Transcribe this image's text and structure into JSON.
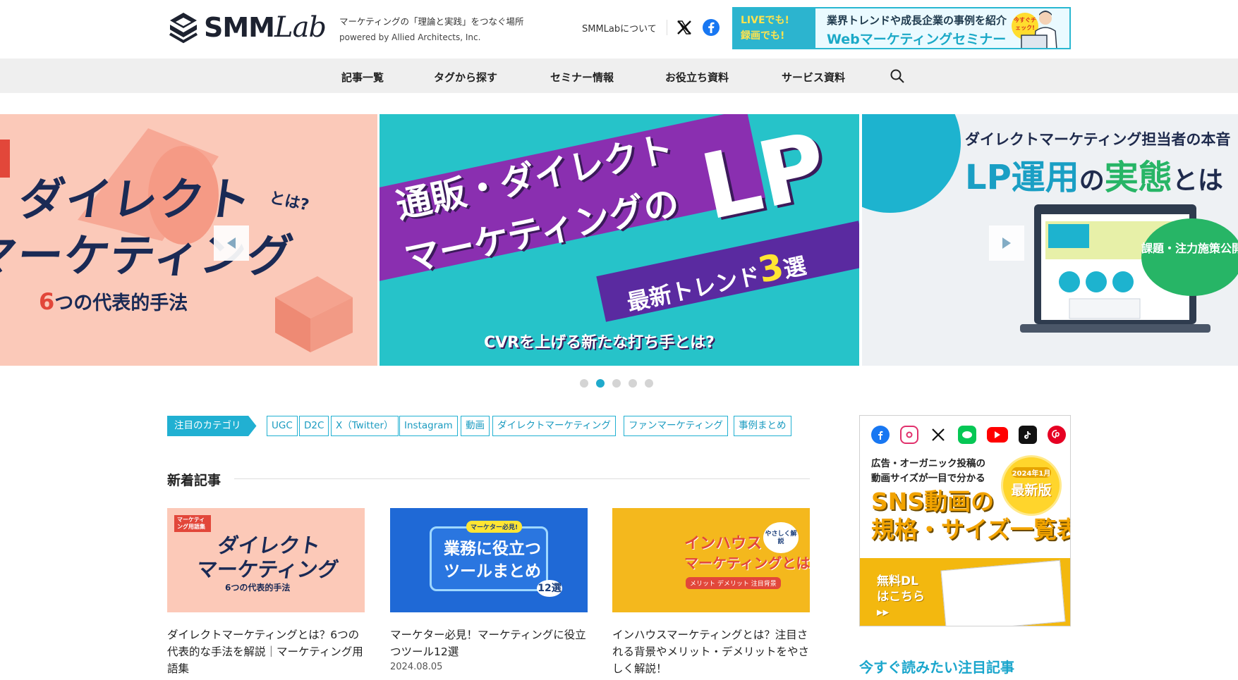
{
  "header": {
    "logo_text": "SMM",
    "logo_text_lab": "Lab",
    "tagline": "マーケティングの「理論と実践」をつなぐ場所",
    "powered_by": "powered by Allied Architects, Inc.",
    "about_link": "SMMLabについて",
    "seminar": {
      "live": "LIVEでも!",
      "recorded": "録画でも!",
      "line1": "業界トレンドや成長企業の事例を紹介",
      "line2": "Webマーケティングセミナー",
      "badge": "今すぐチェック!"
    }
  },
  "nav": {
    "items": [
      "記事一覧",
      "タグから探す",
      "セミナー情報",
      "お役立ち資料",
      "サービス資料"
    ]
  },
  "carousel": {
    "left": {
      "line1": "ダイレクト",
      "line2": "マーケティング",
      "toha": "とは?",
      "sub_num": "6",
      "sub_text": "つの代表的手法"
    },
    "center": {
      "line1": "通販・ダイレクト",
      "line2": "マーケティングの",
      "lp": "LP",
      "trend": "最新トレンド",
      "trend_num": "3",
      "trend_tail": "選",
      "cta": "CVRを上げる新たな打ち手とは?"
    },
    "right": {
      "line1": "ダイレクトマーケティング担当者の本音",
      "line2a": "LP運用",
      "line2b": "の",
      "line2c": "実態",
      "line2d": "とは",
      "bubble": "課題・注力施策公開"
    },
    "dots": 5,
    "active_dot": 1
  },
  "categories": {
    "label": "注目のカテゴリ",
    "tags": [
      "UGC",
      "D2C",
      "X（Twitter）",
      "Instagram",
      "動画",
      "ダイレクトマーケティング",
      "ファンマーケティング",
      "事例まとめ"
    ]
  },
  "articles": {
    "section_title": "新着記事",
    "items": [
      {
        "title": "ダイレクトマーケティングとは？6つの代表的な手法を解説｜マーケティング用語集",
        "date": "",
        "thumb_badge": "マーケティング用語集",
        "thumb_line1": "ダイレクト",
        "thumb_line2": "マーケティング",
        "thumb_sub": "6つの代表的手法"
      },
      {
        "title": "マーケター必見！マーケティングに役立つツール12選",
        "date": "2024.08.05",
        "thumb_badge": "マーケター必見!",
        "thumb_line1": "業務に役立つ",
        "thumb_line2": "ツールまとめ",
        "thumb_sub": "12選"
      },
      {
        "title": "インハウスマーケティングとは？注目される背景やメリット・デメリットをやさしく解説！",
        "date": "",
        "thumb_badge": "やさしく解説",
        "thumb_line1": "インハウス",
        "thumb_line2": "マーケティングとは",
        "thumb_sub": "メリット デメリット 注目背景"
      }
    ]
  },
  "sidebar": {
    "ad": {
      "desc_line1": "広告・オーガニック投稿の",
      "desc_line2": "動画サイズが一目で分かる",
      "badge_small": "2024年1月",
      "badge_big": "最新版",
      "title_line1": "SNS動画の",
      "title_line2": "規格・サイズ一覧表",
      "dl_line1": "無料DL",
      "dl_line2": "はこちら",
      "dl_arrow": "▸▸"
    },
    "heading": "今すぐ読みたい注目記事"
  },
  "colors": {
    "accent": "#21b0d2",
    "nav_bg": "#efefef",
    "slide_left_bg": "#fbc9b9",
    "slide_center_bg": "#26c3c9",
    "slide_right_bg": "#eef1f4"
  }
}
